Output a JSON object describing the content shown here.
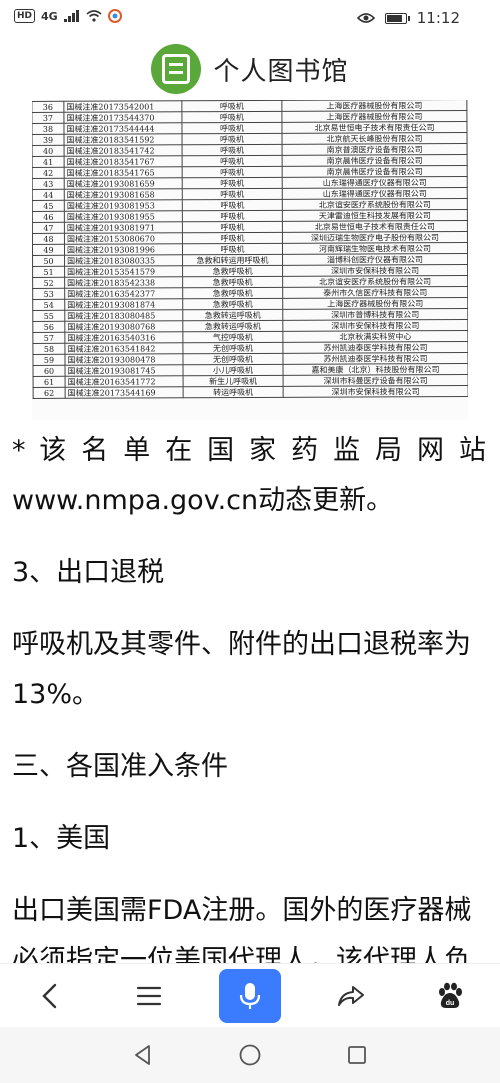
{
  "status_bar": {
    "left_badge": "HD",
    "network": "4G",
    "time": "11:12",
    "battery_level": 0.85
  },
  "header": {
    "logo_char": "",
    "site_name": "个人图书馆"
  },
  "registry_table": {
    "rows": [
      [
        "36",
        "国械注准20173542001",
        "呼吸机",
        "上海医疗器械股份有限公司"
      ],
      [
        "37",
        "国械注准20173544370",
        "呼吸机",
        "上海医疗器械股份有限公司"
      ],
      [
        "38",
        "国械注准20173544444",
        "呼吸机",
        "北京易世恒电子技术有限责任公司"
      ],
      [
        "39",
        "国械注准20183541592",
        "呼吸机",
        "北京航天长峰股份有限公司"
      ],
      [
        "40",
        "国械注准20183541742",
        "呼吸机",
        "南京普澳医疗设备有限公司"
      ],
      [
        "41",
        "国械注准20183541767",
        "呼吸机",
        "南京晨伟医疗设备有限公司"
      ],
      [
        "42",
        "国械注准20183541765",
        "呼吸机",
        "南京晨伟医疗设备有限公司"
      ],
      [
        "43",
        "国械注准20193081659",
        "呼吸机",
        "山东瑞得通医疗仪器有限公司"
      ],
      [
        "44",
        "国械注准20193081658",
        "呼吸机",
        "山东瑞得通医疗仪器有限公司"
      ],
      [
        "45",
        "国械注准20193081953",
        "呼吸机",
        "北京谊安医疗系统股份有限公司"
      ],
      [
        "46",
        "国械注准20193081955",
        "呼吸机",
        "天津雷迪恒生科技发展有限公司"
      ],
      [
        "47",
        "国械注准20193081971",
        "呼吸机",
        "北京易世恒电子技术有限责任公司"
      ],
      [
        "48",
        "国械注准20153080670",
        "呼吸机",
        "深圳迈瑞生物医疗电子股份有限公司"
      ],
      [
        "49",
        "国械注准20193081996",
        "呼吸机",
        "河南辉瑞生物医电技术有限公司"
      ],
      [
        "50",
        "国械注准20183080335",
        "急救和转运用呼吸机",
        "淄博科创医疗仪器有限公司"
      ],
      [
        "51",
        "国械注准20153541579",
        "急救呼吸机",
        "深圳市安保科技有限公司"
      ],
      [
        "52",
        "国械注准20183542338",
        "急救呼吸机",
        "北京谊安医疗系统股份有限公司"
      ],
      [
        "53",
        "国械注准20163542377",
        "急救呼吸机",
        "泰州市久信医疗科技有限公司"
      ],
      [
        "54",
        "国械注准20193081874",
        "急救呼吸机",
        "上海医疗器械股份有限公司"
      ],
      [
        "55",
        "国械注准20183080485",
        "急救转运呼吸机",
        "深圳市普博科技有限公司"
      ],
      [
        "56",
        "国械注准20193080768",
        "急救转运呼吸机",
        "深圳市安保科技有限公司"
      ],
      [
        "57",
        "国械注准20163540316",
        "气控呼吸机",
        "北京秋满实科贸中心"
      ],
      [
        "58",
        "国械注准20163541842",
        "无创呼吸机",
        "苏州凯迪泰医学科技有限公司"
      ],
      [
        "59",
        "国械注准20193080478",
        "无创呼吸机",
        "苏州凯迪泰医学科技有限公司"
      ],
      [
        "60",
        "国械注准20193081745",
        "小儿呼吸机",
        "嘉和美康（北京）科技股份有限公司"
      ],
      [
        "61",
        "国械注准20163541772",
        "新生儿呼吸机",
        "深圳市科曼医疗设备有限公司"
      ],
      [
        "62",
        "国械注准20173544169",
        "转运呼吸机",
        "深圳市安保科技有限公司"
      ]
    ]
  },
  "article": {
    "note_line1": "* 该 名 单 在 国 家 药 监 局 网 站",
    "note_line2": "www.nmpa.gov.cn动态更新。",
    "sec_export_tax": "3、出口退税",
    "export_tax_text": "呼吸机及其零件、附件的出口退税率为13%。",
    "sec_access": "三、各国准入条件",
    "sec_usa": "1、美国",
    "usa_text": "出口美国需FDA注册。国外的医疗器械必须指定一位美国代理人，该代理人负"
  },
  "toolbar": {
    "accent": "#3b7cff",
    "icons": [
      "back-icon",
      "menu-icon",
      "microphone-icon",
      "share-icon",
      "baidu-paw-icon"
    ]
  },
  "navbar": {
    "icons": [
      "nav-back-icon",
      "nav-home-icon",
      "nav-recents-icon"
    ]
  }
}
